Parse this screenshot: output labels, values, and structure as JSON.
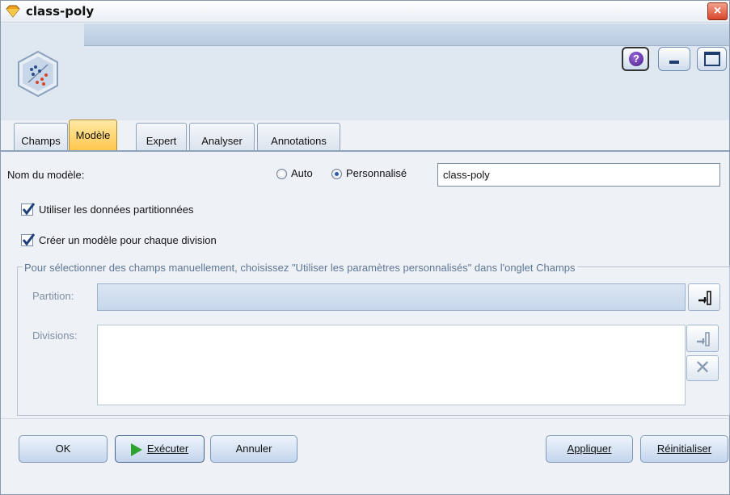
{
  "window": {
    "title": "class-poly",
    "close_icon": "×",
    "help_icon": "?"
  },
  "tabs": [
    {
      "label": "Champs",
      "active": false
    },
    {
      "label": "Modèle",
      "active": true
    },
    {
      "label": "Expert",
      "active": false
    },
    {
      "label": "Analyser",
      "active": false
    },
    {
      "label": "Annotations",
      "active": false
    }
  ],
  "model": {
    "name_label": "Nom du modèle:",
    "radio_auto_label": "Auto",
    "radio_custom_label": "Personnalisé",
    "selected_mode": "Personnalisé",
    "name_value": "class-poly",
    "use_partitioned_label": "Utiliser les données partitionnées",
    "use_partitioned_checked": true,
    "split_model_label": "Créer un modèle pour chaque division",
    "split_model_checked": true
  },
  "fields_group": {
    "title": "Pour sélectionner des champs manuellement, choisissez \"Utiliser les paramètres personnalisés\" dans l'onglet Champs",
    "partition_label": "Partition:",
    "partition_value": "",
    "divisions_label": "Divisions:",
    "divisions_items": []
  },
  "buttons": {
    "ok": "OK",
    "run": "Exécuter",
    "cancel": "Annuler",
    "apply": "Appliquer",
    "reset": "Réinitialiser"
  },
  "colors": {
    "active_tab": "#ffc64a",
    "header_bg": "#dfe7f1",
    "close_button": "#d8462a",
    "run_icon": "#2fa32f"
  }
}
